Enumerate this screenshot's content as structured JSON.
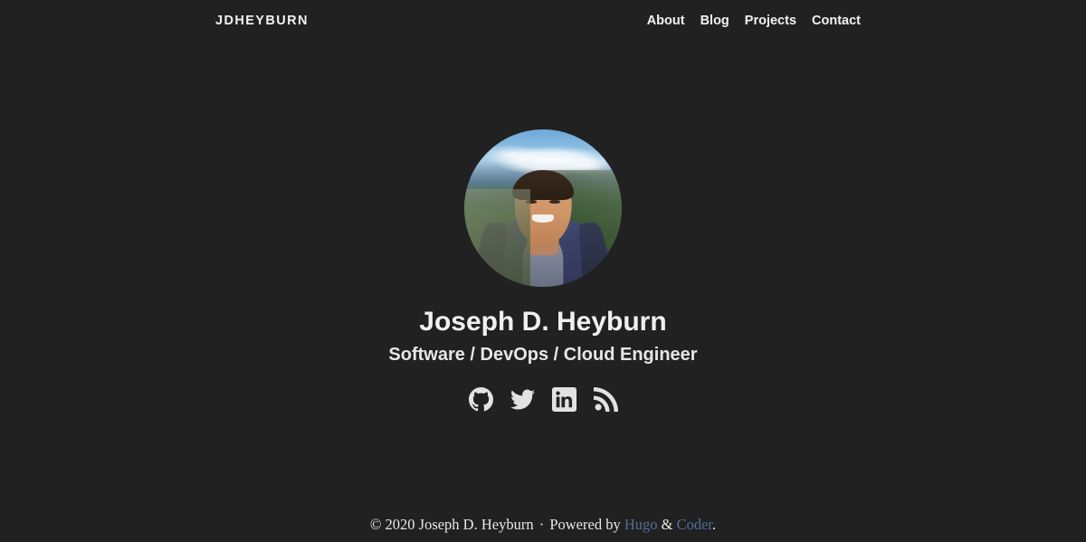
{
  "page": {
    "background_color": "#212121",
    "text_color": "#eaeaea",
    "link_color": "#4f7198"
  },
  "header": {
    "brand": "JDHEYBURN",
    "nav": [
      {
        "label": "About"
      },
      {
        "label": "Blog"
      },
      {
        "label": "Projects"
      },
      {
        "label": "Contact"
      }
    ]
  },
  "profile": {
    "avatar_alt": "Portrait photo of Joseph D. Heyburn smiling outdoors in a blue jacket with mountains behind",
    "name": "Joseph D. Heyburn",
    "tagline": "Software / DevOps / Cloud Engineer",
    "social": [
      {
        "icon": "github-icon",
        "label": "GitHub"
      },
      {
        "icon": "twitter-icon",
        "label": "Twitter"
      },
      {
        "icon": "linkedin-icon",
        "label": "LinkedIn"
      },
      {
        "icon": "rss-icon",
        "label": "RSS"
      }
    ]
  },
  "footer": {
    "copyright": "© 2020 Joseph D. Heyburn",
    "separator": "·",
    "powered_by": "Powered by",
    "hugo_label": "Hugo",
    "ampersand": "&",
    "coder_label": "Coder",
    "period": "."
  }
}
